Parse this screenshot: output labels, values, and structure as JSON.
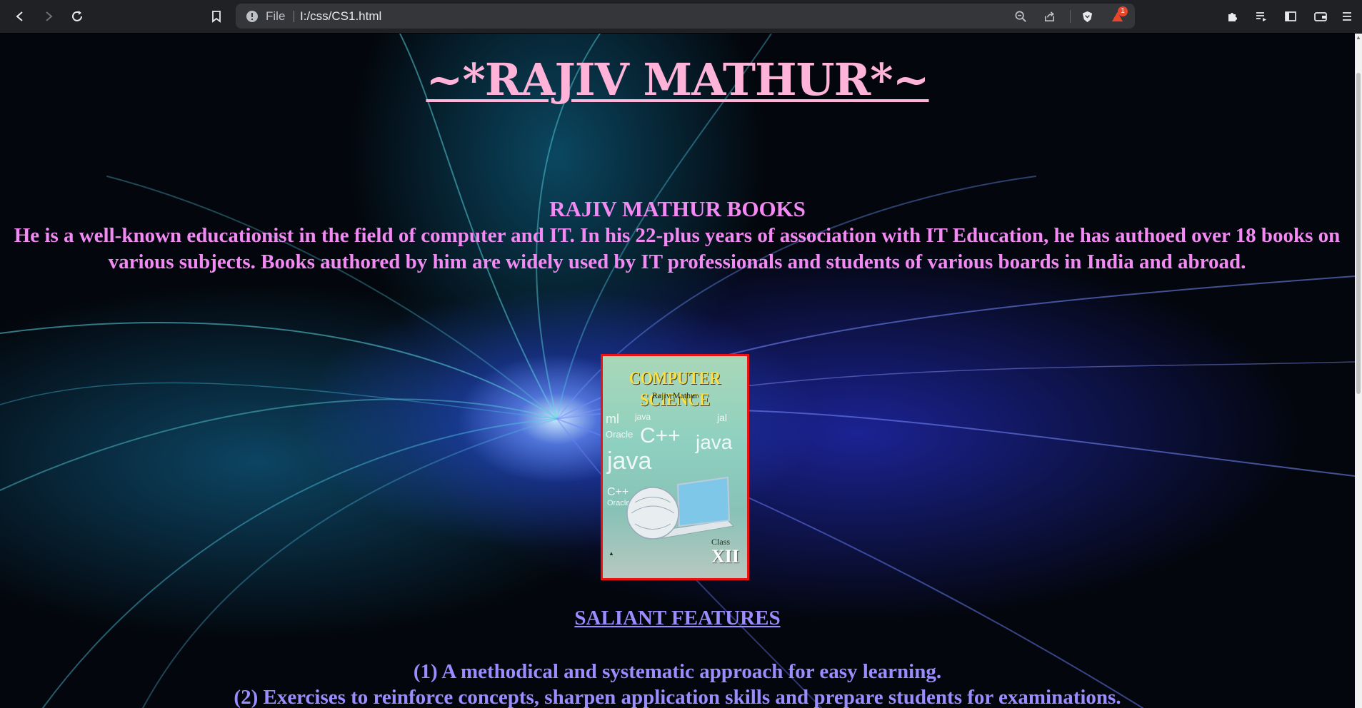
{
  "browser": {
    "address_scheme": "File",
    "address_url": "I:/css/CS1.html",
    "notification_count": "1",
    "icons": [
      "back-icon",
      "forward-icon",
      "reload-icon",
      "bookmark-icon",
      "info-icon",
      "zoom-icon",
      "share-icon",
      "brave-shield-icon",
      "brave-rewards-icon",
      "extensions-icon",
      "playlist-icon",
      "sidebar-icon",
      "wallet-icon",
      "menu-icon"
    ]
  },
  "page": {
    "title": "~*RAJIV MATHUR*~",
    "books_heading": "RAJIV MATHUR BOOKS",
    "intro": "He is a well-known educationist in the field of computer and IT. In his 22-plus years of association with IT Education, he has authoed over 18 books on various subjects. Books authored by him are widely used by IT professionals and students of various boards in India and abroad.",
    "book_cover": {
      "title": "COMPUTER SCIENCE",
      "author": "Rajiv Mathur",
      "class_label": "Class",
      "class_number": "XII"
    },
    "features_heading": "SALIANT FEATURES",
    "features": [
      "(1) A methodical and systematic approach for easy learning.",
      "(2) Exercises to reinforce concepts, sharpen application skills and prepare students for examinations."
    ]
  },
  "colors": {
    "title": "#ffb3d9",
    "intro": "#f389f3",
    "features": "#9d8cff",
    "cover_border": "#ee1111"
  }
}
